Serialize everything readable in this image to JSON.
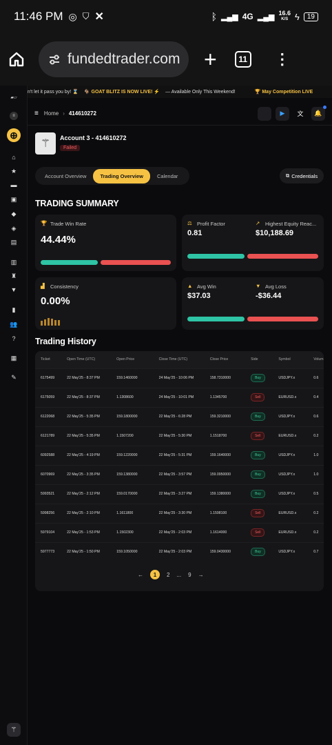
{
  "status_bar": {
    "time": "11:46 PM",
    "network": "4G",
    "speed": "16.6",
    "speed_unit": "K/S",
    "battery": "19"
  },
  "browser": {
    "url": "fundedtrader.com",
    "tab_count": "11"
  },
  "ticker": {
    "items": [
      "n't let it pass you by! ⌛",
      "🐐 GOAT BLITZ IS NOW LIVE! ⚡",
      "— Available Only This Weekend!",
      "🏆 May Competition LIVE"
    ]
  },
  "breadcrumb": {
    "home": "Home",
    "current": "414610272"
  },
  "account": {
    "title": "Account 3 - 414610272",
    "status": "Failed"
  },
  "tabs": {
    "overview": "Account Overview",
    "trading": "Trading Overview",
    "calendar": "Calendar"
  },
  "credentials_label": "Credentials",
  "trading_summary": {
    "title": "TRADING SUMMARY",
    "win_rate_label": "Trade Win Rate",
    "win_rate": "44.44%",
    "profit_factor_label": "Profit Factor",
    "profit_factor": "0.81",
    "highest_equity_label": "Highest Equity Reac...",
    "highest_equity": "$10,188.69",
    "consistency_label": "Consistency",
    "consistency": "0.00%",
    "avg_win_label": "Avg Win",
    "avg_win": "$37.03",
    "avg_loss_label": "Avg Loss",
    "avg_loss": "-$36.44"
  },
  "trading_history": {
    "title": "Trading History",
    "columns": [
      "Ticket",
      "Open Time (UTC)",
      "Open Price",
      "Close Time (UTC)",
      "Close Price",
      "Side",
      "Symbol",
      "Volum"
    ],
    "rows": [
      [
        "6175499",
        "22 May'25 - 8:37 PM",
        "159.1460000",
        "24 May'25 - 10:06 PM",
        "158.7310000",
        "Buy",
        "USDJPY.x",
        "0.6"
      ],
      [
        "6175059",
        "22 May'25 - 8:37 PM",
        "1.1308600",
        "24 May'25 - 10:01 PM",
        "1.1345700",
        "Sell",
        "EURUSD.x",
        "0.4"
      ],
      [
        "6122068",
        "22 May'25 - 5:35 PM",
        "159.1800000",
        "22 May'25 - 6:28 PM",
        "159.3210000",
        "Buy",
        "USDJPY.x",
        "0.6"
      ],
      [
        "6121789",
        "22 May'25 - 5:35 PM",
        "1.1507200",
        "22 May'25 - 5:30 PM",
        "1.1518700",
        "Sell",
        "EURUSD.x",
        "0.2"
      ],
      [
        "6092588",
        "22 May'25 - 4:19 PM",
        "159.1220000",
        "22 May'25 - 5:31 PM",
        "159.1640000",
        "Buy",
        "USDJPY.x",
        "1.0"
      ],
      [
        "6070969",
        "22 May'25 - 3:35 PM",
        "159.1380000",
        "22 May'25 - 3:57 PM",
        "159.0950000",
        "Buy",
        "USDJPY.x",
        "1.0"
      ],
      [
        "5993521",
        "22 May'25 - 2:12 PM",
        "159.0170000",
        "22 May'25 - 3:27 PM",
        "159.1380000",
        "Buy",
        "USDJPY.x",
        "0.5"
      ],
      [
        "5998256",
        "22 May'25 - 2:10 PM",
        "1.1611800",
        "22 May'25 - 3:30 PM",
        "1.1598100",
        "Sell",
        "EURUSD.x",
        "0.2"
      ],
      [
        "5979104",
        "22 May'25 - 1:53 PM",
        "1.1502300",
        "22 May'25 - 2:03 PM",
        "1.1614000",
        "Sell",
        "EURUSD.x",
        "0.2"
      ],
      [
        "5977773",
        "22 May'25 - 1:50 PM",
        "159.1050000",
        "22 May'25 - 2:03 PM",
        "159.0430000",
        "Buy",
        "USDJPY.x",
        "0.7"
      ]
    ]
  },
  "pagination": {
    "prev": "←",
    "pages": [
      "1",
      "2",
      "...",
      "9"
    ],
    "next": "→"
  },
  "colors": {
    "accent": "#f6c244",
    "buy": "#3fcf9a",
    "sell": "#ef5d5d",
    "win_bar": "#2ec4a5",
    "loss_bar": "#ea5151"
  }
}
